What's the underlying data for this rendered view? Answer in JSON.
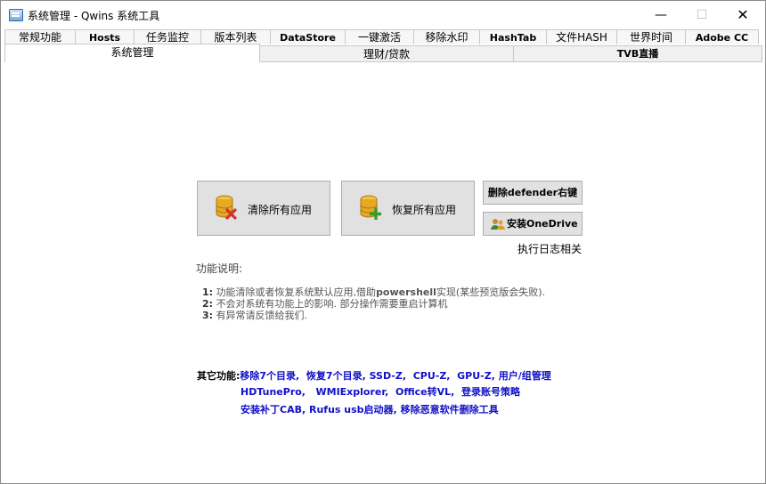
{
  "window": {
    "title": "系统管理 - Qwins 系统工具",
    "minimize": "—",
    "maximize": "☐",
    "close": "✕"
  },
  "tabs_row1": [
    "常规功能",
    "Hosts",
    "任务监控",
    "版本列表",
    "DataStore",
    "一键激活",
    "移除水印",
    "HashTab",
    "文件HASH",
    "世界时间",
    "Adobe CC"
  ],
  "tabs_row2": [
    "系统管理",
    "理财/贷款",
    "TVB直播"
  ],
  "buttons": {
    "clear_apps": "清除所有应用",
    "restore_apps": "恢复所有应用",
    "remove_defender": "删除defender右键",
    "install_onedrive": "安装OneDrive"
  },
  "log_label": "执行日志相关",
  "func_title": "功能说明:",
  "desc": {
    "n1": "1:",
    "l1a": "功能清除或者恢复系统默认应用,借助",
    "l1b": "powershell",
    "l1c": "实现(某些预览版会失败).",
    "n2": "2:",
    "l2": "不会对系统有功能上的影响. 部分操作需要重启计算机",
    "n3": "3:",
    "l3": "有异常请反馈给我们."
  },
  "other": {
    "label": "其它功能:",
    "links1": [
      "移除7个目录,",
      "恢复7个目录,",
      "SSD-Z,",
      "CPU-Z,",
      "GPU-Z,",
      "用户/组管理"
    ],
    "links2": [
      "HDTunePro,",
      "WMIExplorer,",
      "Office转VL,",
      "登录账号策略"
    ],
    "links3": [
      "安装补丁CAB,",
      "Rufus usb启动器,",
      "移除恶意软件删除工具"
    ]
  },
  "colors": {
    "link": "#1010c8",
    "button_bg": "#e1e1e1",
    "accent_red": "#d9302b",
    "accent_green": "#3a9a2a"
  }
}
